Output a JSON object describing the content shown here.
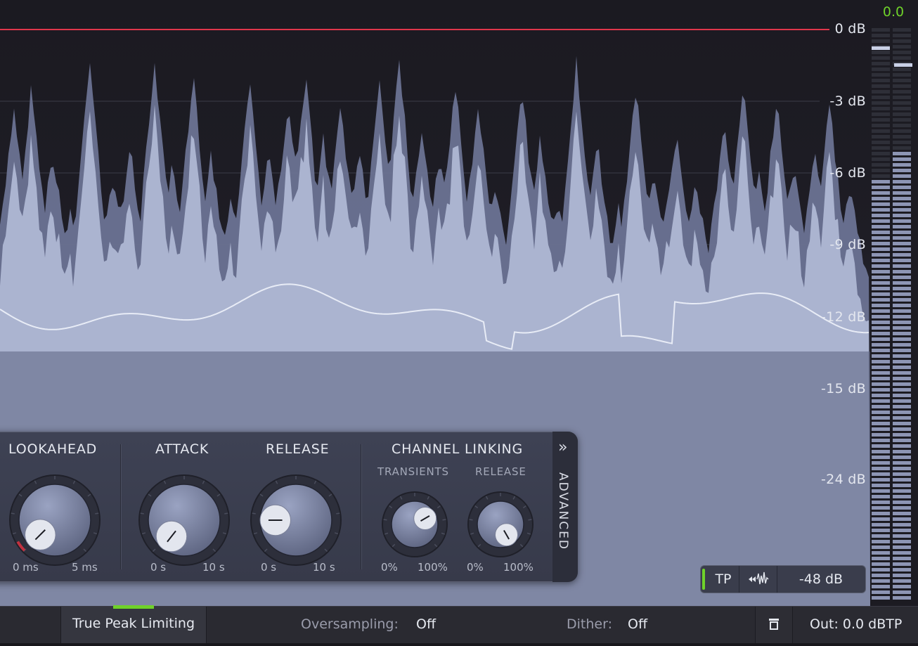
{
  "display": {
    "db_labels": [
      "0 dB",
      "-3 dB",
      "-6 dB",
      "-9 dB",
      "-12 dB",
      "-15 dB",
      "-24 dB"
    ],
    "colors": {
      "peak_line": "#e0364b",
      "waveform_outer": "#6b7393",
      "waveform_inner": "#b2bbd7",
      "gain_line": "#e8ecf6"
    }
  },
  "meter": {
    "value": "0.0",
    "value_color": "#6fd22a"
  },
  "panel": {
    "lookahead": {
      "title": "LOOKAHEAD",
      "min": "0 ms",
      "max": "5 ms"
    },
    "attack": {
      "title": "ATTACK",
      "min": "0 s",
      "max": "10 s"
    },
    "release": {
      "title": "RELEASE",
      "min": "0 s",
      "max": "10 s"
    },
    "channel_linking": {
      "title": "CHANNEL LINKING",
      "transients": {
        "title": "TRANSIENTS",
        "min": "0%",
        "max": "100%"
      },
      "release": {
        "title": "RELEASE",
        "min": "0%",
        "max": "100%"
      }
    },
    "advanced": {
      "label": "ADVANCED",
      "chevron": "»"
    }
  },
  "tp_bar": {
    "tp_label": "TP",
    "range_value": "-48 dB"
  },
  "bottom": {
    "true_peak_label": "True Peak Limiting",
    "oversampling_label": "Oversampling:",
    "oversampling_value": "Off",
    "dither_label": "Dither:",
    "dither_value": "Off",
    "output_label": "Out: 0.0 dBTP"
  }
}
